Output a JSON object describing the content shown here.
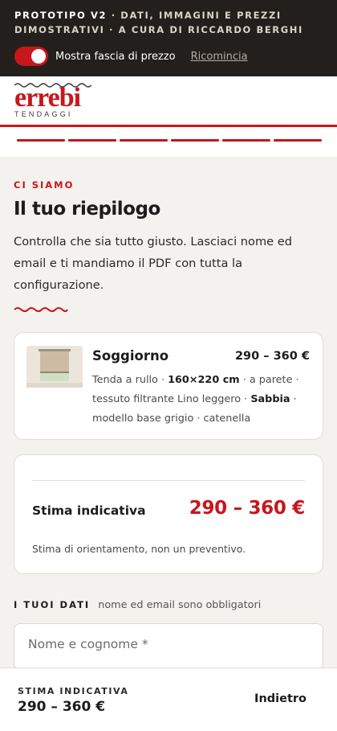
{
  "topbar": {
    "prototype": "PROTOTIPO V2",
    "line1_rest": " · DATI, IMMAGINI E PREZZI",
    "line2": "DIMOSTRATIVI · A CURA DI RICCARDO BERGHI",
    "toggle_label": "Mostra fascia di prezzo",
    "toggle_on": true,
    "reset_link": "Ricomincia"
  },
  "brand": {
    "logo_word": "errebi",
    "logo_sub": "TENDAGGI",
    "progress_steps": 6,
    "accent": "#c8161c"
  },
  "main": {
    "eyebrow": "CI SIAMO",
    "title": "Il tuo riepilogo",
    "intro": "Controlla che sia tutto giusto. Lasciaci nome ed email e ti mandiamo il PDF con tutta la configurazione."
  },
  "summary": {
    "room": "Soggiorno",
    "price": "290 – 360 €",
    "desc_1": "Tenda a rullo · ",
    "desc_size": "160×220 cm",
    "desc_2": " · a parete · tessuto filtrante Lino leggero · ",
    "desc_color": "Sabbia",
    "desc_3": " · modello base grigio · catenella"
  },
  "estimate": {
    "label": "Stima indicativa",
    "value": "290 – 360 €",
    "note": "Stima di orientamento, non un preventivo."
  },
  "form": {
    "section_label": "I TUOI DATI",
    "section_hint": "nome ed email sono obbligatori",
    "name_placeholder": "Nome e cognome *"
  },
  "bottom_bar": {
    "label": "STIMA INDICATIVA",
    "value": "290 – 360 €",
    "back_button": "Indietro"
  }
}
